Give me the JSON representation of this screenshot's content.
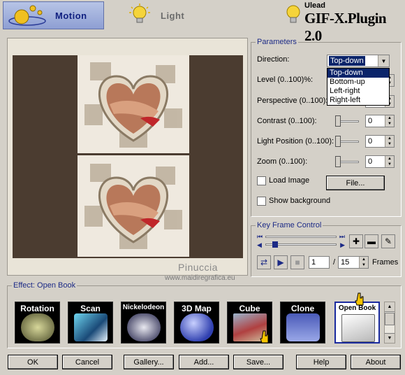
{
  "header": {
    "tabs": [
      {
        "label": "Motion",
        "active": true
      },
      {
        "label": "Light",
        "active": false
      }
    ],
    "brand": {
      "small": "Ulead",
      "big": "GIF-X.Plugin 2.0"
    }
  },
  "preview": {
    "credit_name": "Pinuccia",
    "credit_site": "www.maidiregrafica.eu"
  },
  "parameters": {
    "title": "Parameters",
    "direction": {
      "label": "Direction:",
      "value": "Top-down",
      "options": [
        "Top-down",
        "Bottom-up",
        "Left-right",
        "Right-left"
      ]
    },
    "level": {
      "label": "Level (0..100)%:"
    },
    "perspective": {
      "label": "Perspective (0..100):"
    },
    "contrast": {
      "label": "Contrast (0..100):",
      "value": "0"
    },
    "light_position": {
      "label": "Light Position (0..100):",
      "value": "0"
    },
    "zoom": {
      "label": "Zoom (0..100):",
      "value": "0"
    },
    "load_image": {
      "label": "Load Image",
      "checked": false
    },
    "file_button": "File...",
    "show_background": {
      "label": "Show background",
      "checked": false
    }
  },
  "keyframe": {
    "title": "Key Frame Control",
    "current": "1",
    "separator": "/",
    "total": "15",
    "frames_label": "Frames"
  },
  "effects": {
    "title": "Effect: Open Book",
    "items": [
      {
        "label": "Rotation",
        "icon": "fan-blade"
      },
      {
        "label": "Scan",
        "icon": "light-beam"
      },
      {
        "label": "Nickelodeon",
        "icon": "star-sphere"
      },
      {
        "label": "3D Map",
        "icon": "globe"
      },
      {
        "label": "Cube",
        "icon": "cube"
      },
      {
        "label": "Clone",
        "icon": "ulead-logo"
      },
      {
        "label": "Open Book",
        "icon": "open-book",
        "selected": true
      }
    ]
  },
  "buttons": {
    "ok": "OK",
    "cancel": "Cancel",
    "gallery": "Gallery...",
    "add": "Add...",
    "save": "Save...",
    "help": "Help",
    "about": "About"
  },
  "colors": {
    "accent": "#1c2a86",
    "selection": "#0a246a",
    "preview_bg": "#4b3c30"
  }
}
